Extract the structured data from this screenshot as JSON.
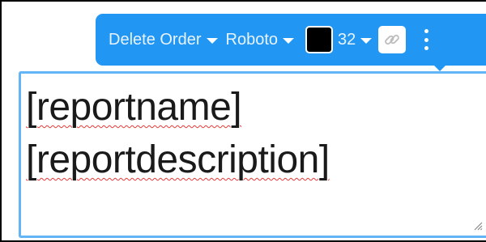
{
  "toolbar": {
    "order_dropdown": "Delete Order",
    "font_dropdown": "Roboto",
    "text_color": "#000000",
    "font_size": "32",
    "link_icon": "link-icon",
    "more_icon": "more-vertical-icon",
    "accent_color": "#2196f3"
  },
  "text_box": {
    "line_1": "[reportname]",
    "line_2": "[reportdescription]"
  }
}
